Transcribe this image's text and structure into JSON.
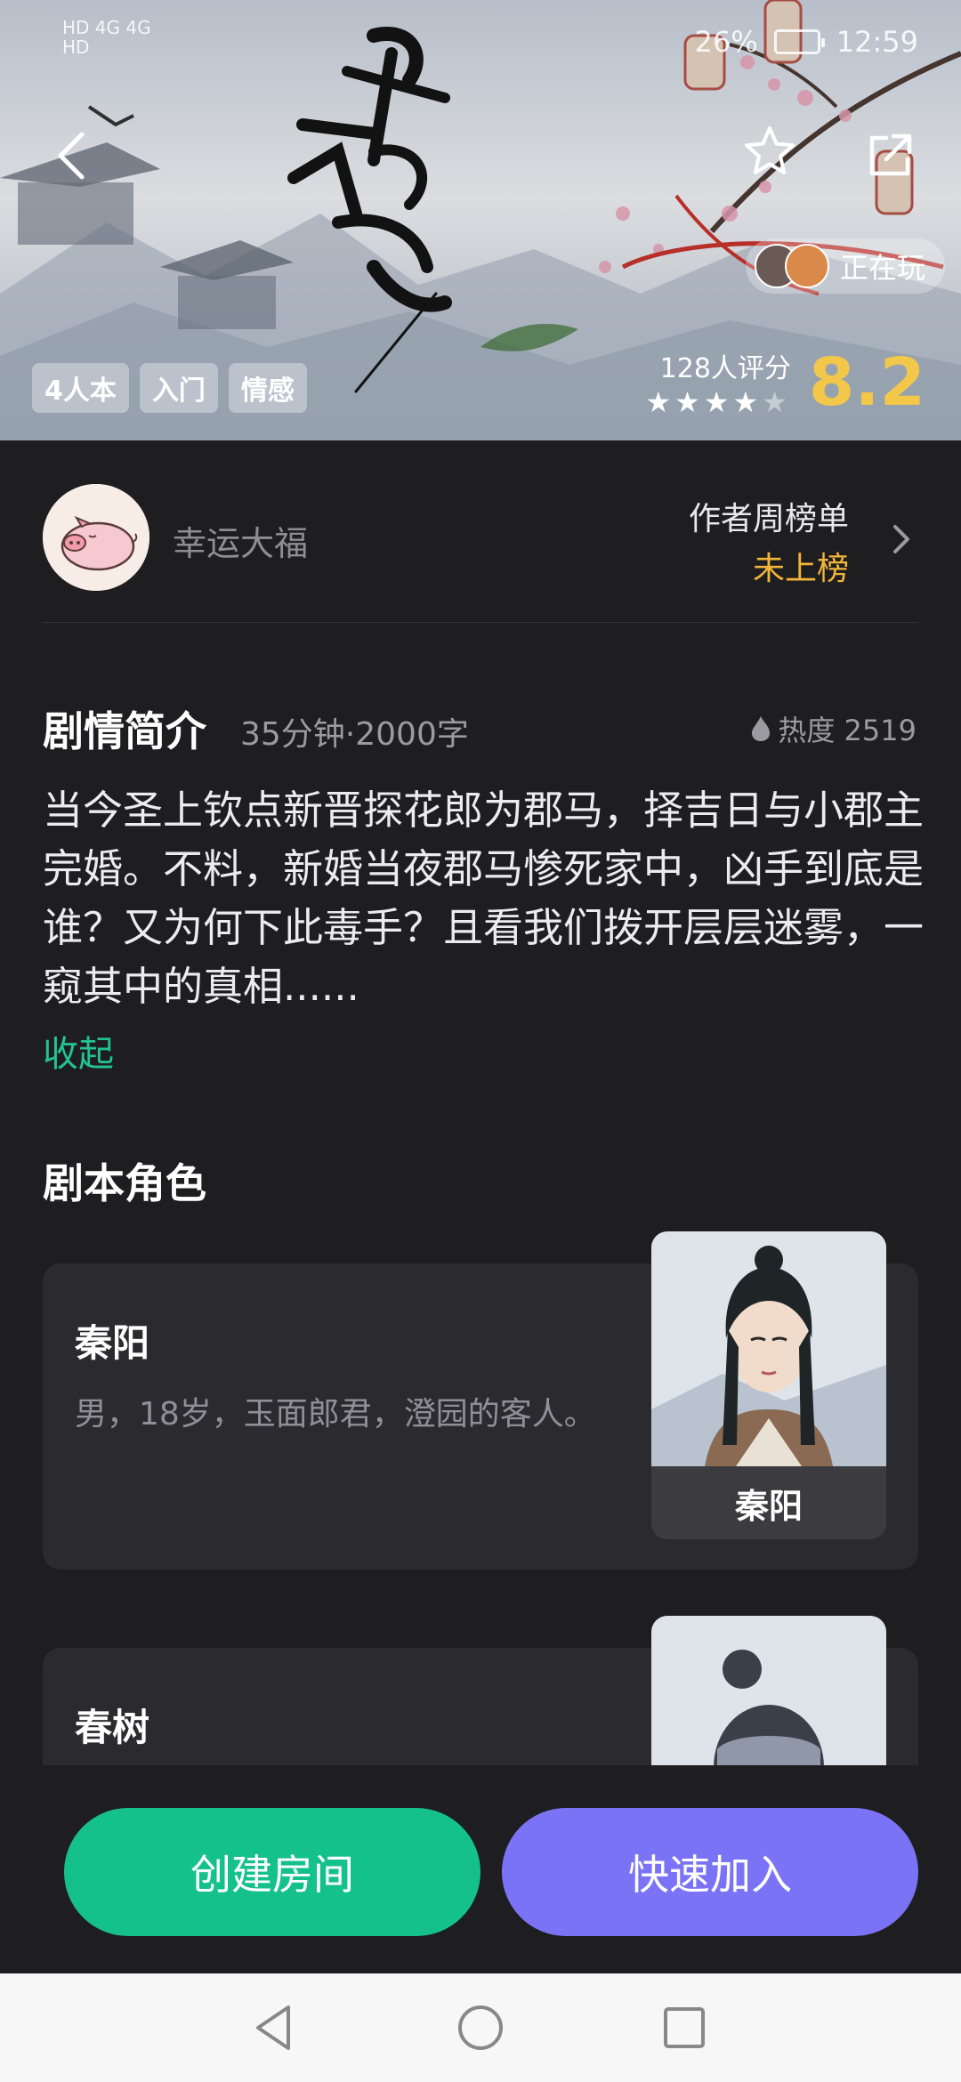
{
  "status_bar": {
    "left_top": "HD 4G 4G",
    "left_bottom": "HD",
    "battery": "26%",
    "time": "12:59"
  },
  "hero": {
    "calligraphy": "长相思",
    "tags": [
      "4人本",
      "入门",
      "情感"
    ],
    "playing_label": "正在玩",
    "rating_count": "128人评分",
    "rating_score": "8.2",
    "stars_filled": 4,
    "stars_total": 5
  },
  "author": {
    "name": "幸运大福",
    "rank_label": "作者周榜单",
    "rank_value": "未上榜"
  },
  "synopsis": {
    "title": "剧情简介",
    "meta": "35分钟·2000字",
    "heat": "热度 2519",
    "text": "当今圣上钦点新晋探花郎为郡马，择吉日与小郡主完婚。不料，新婚当夜郡马惨死家中，凶手到底是谁？又为何下此毒手？且看我们拨开层层迷雾，一窥其中的真相......",
    "collapse_label": "收起"
  },
  "roles": {
    "title": "剧本角色",
    "items": [
      {
        "name": "秦阳",
        "desc": "男，18岁，玉面郎君，澄园的客人。",
        "portrait_label": "秦阳"
      },
      {
        "name": "春树",
        "desc": "",
        "portrait_label": ""
      }
    ]
  },
  "actions": {
    "create": "创建房间",
    "join": "快速加入"
  },
  "colors": {
    "accent_green": "#15c18b",
    "accent_purple": "#7b73f6",
    "score_gold": "#f2c74a",
    "rank_gold": "#f2b43a",
    "background": "#1e1e21"
  }
}
